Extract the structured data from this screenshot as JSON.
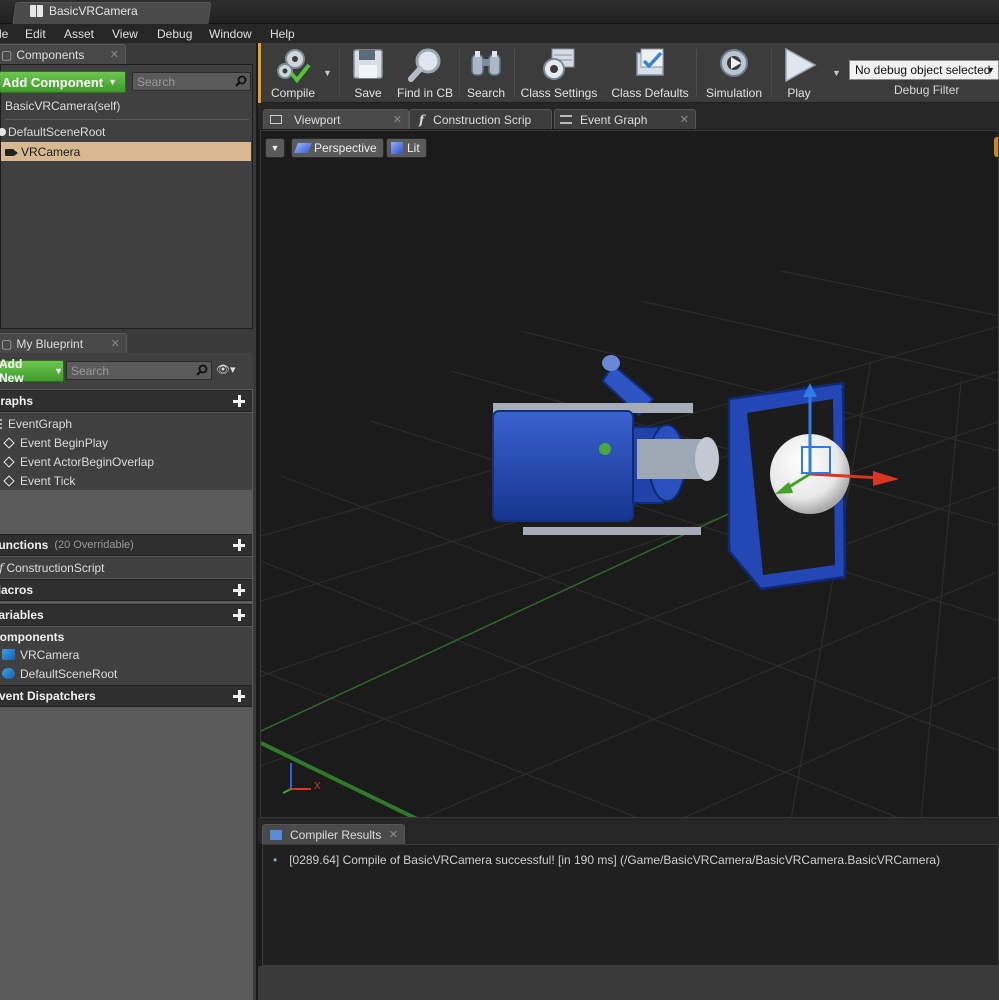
{
  "window": {
    "tab_title": "BasicVRCamera"
  },
  "menu": [
    "File",
    "Edit",
    "Asset",
    "View",
    "Debug",
    "Window",
    "Help"
  ],
  "components_panel": {
    "tab_label": "Components",
    "add_button": "Add Component",
    "search_placeholder": "Search",
    "self_label": "BasicVRCamera(self)",
    "tree": [
      {
        "label": "DefaultSceneRoot",
        "selected": false
      },
      {
        "label": "VRCamera",
        "selected": true
      }
    ]
  },
  "my_blueprint": {
    "tab_label": "My Blueprint",
    "add_button": "Add New",
    "search_placeholder": "Search",
    "sections": {
      "graphs": "Graphs",
      "functions": "Functions",
      "functions_sub": "(20 Overridable)",
      "macros": "Macros",
      "variables": "Variables",
      "components": "Components",
      "event_dispatchers": "Event Dispatchers"
    },
    "graph_items": [
      "EventGraph",
      "Event BeginPlay",
      "Event ActorBeginOverlap",
      "Event Tick"
    ],
    "function_items": [
      "ConstructionScript"
    ],
    "component_items": [
      "VRCamera",
      "DefaultSceneRoot"
    ]
  },
  "toolbar": {
    "compile": "Compile",
    "save": "Save",
    "find_in_cb": "Find in CB",
    "search": "Search",
    "class_settings": "Class Settings",
    "class_defaults": "Class Defaults",
    "simulation": "Simulation",
    "play": "Play",
    "debug_select": "No debug object selected",
    "debug_filter": "Debug Filter"
  },
  "editor_tabs": [
    "Viewport",
    "Construction Scrip",
    "Event Graph"
  ],
  "viewport": {
    "view_mode": "Perspective",
    "lighting": "Lit",
    "axis_x": "X"
  },
  "compiler_results": {
    "tab_label": "Compiler Results",
    "line": "[0289.64] Compile of BasicVRCamera successful! [in 190 ms] (/Game/BasicVRCamera/BasicVRCamera.BasicVRCamera)"
  },
  "colors": {
    "accent_green": "#4fae35",
    "selection": "#d8b98f",
    "camera_blue": "#1f45b5"
  }
}
